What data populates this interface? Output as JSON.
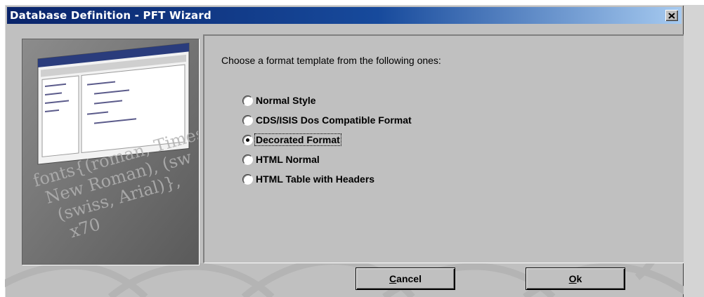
{
  "window": {
    "title": "Database Definition - PFT Wizard",
    "close_label": "×"
  },
  "colors": {
    "titlebar_start": "#0a246a",
    "titlebar_end": "#a6caf0",
    "face": "#c0c0c0"
  },
  "illustration": {
    "watermark_lines": [
      "fonts{(roman, Times",
      "New Roman), (sw",
      "(swiss, Arial)},",
      "x70"
    ]
  },
  "content": {
    "prompt": "Choose a format template from the following ones:",
    "options": [
      {
        "label": "Normal Style",
        "checked": false
      },
      {
        "label": "CDS/ISIS Dos Compatible Format",
        "checked": false
      },
      {
        "label": "Decorated Format",
        "checked": true
      },
      {
        "label": "HTML Normal",
        "checked": false
      },
      {
        "label": "HTML Table with Headers",
        "checked": false
      }
    ]
  },
  "buttons": {
    "cancel": {
      "mnemonic": "C",
      "rest": "ancel"
    },
    "ok": {
      "mnemonic": "O",
      "rest": "k"
    }
  },
  "icons": {
    "close": "close-icon",
    "radio": "radio-button"
  }
}
